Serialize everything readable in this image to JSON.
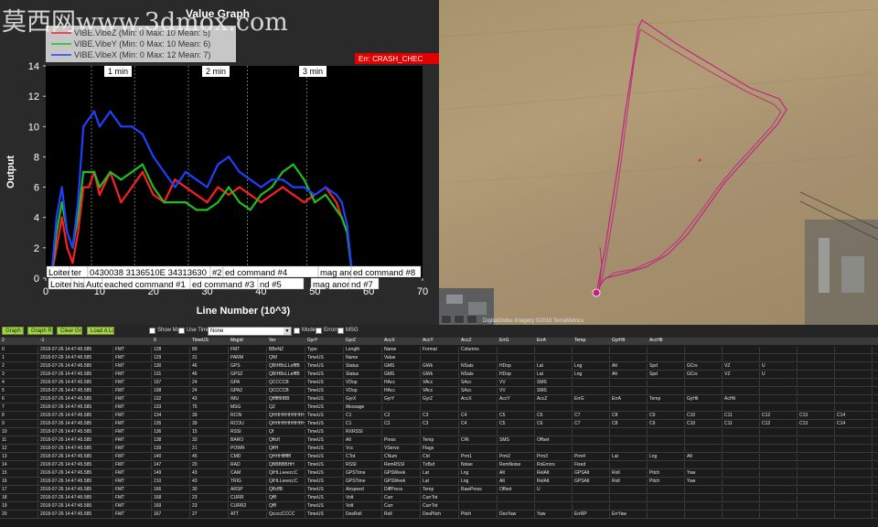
{
  "watermark": "莫西网www.3dmox.com",
  "graph": {
    "title": "Value Graph",
    "legend": [
      {
        "label": "VIBE.VibeZ (Min: 0 Max: 10 Mean: 5)",
        "color": "#ff2020"
      },
      {
        "label": "VIBE.VibeY (Min: 0 Max: 10 Mean: 6)",
        "color": "#1fbf1f"
      },
      {
        "label": "VIBE.VibeX (Min: 0 Max: 12 Mean: 7)",
        "color": "#2040ff"
      }
    ],
    "err_label": "Err: CRASH_CHEC",
    "time_markers": [
      "1 min",
      "2 min",
      "3 min"
    ],
    "mode_labels_row1": [
      "Loiter",
      "ter",
      "0430038 3136510E 34313630",
      "#2",
      "ed command #4",
      "mag anomaly",
      "ed command #8"
    ],
    "mode_labels_row2": [
      "Loiter",
      "his",
      "Auto",
      "eached command #1",
      "ed command #3",
      "nd #5",
      "mag anomaly",
      "nd #7"
    ]
  },
  "chart_data": {
    "type": "line",
    "xlabel": "Line Number (10^3)",
    "ylabel": "Output",
    "xlim": [
      0,
      70
    ],
    "ylim": [
      0,
      14
    ],
    "xticks": [
      0,
      10,
      20,
      30,
      40,
      50,
      60,
      70
    ],
    "yticks": [
      0,
      2,
      4,
      6,
      8,
      10,
      12,
      14
    ],
    "series": [
      {
        "name": "VIBE.VibeZ",
        "color": "#ff2020",
        "x": [
          1,
          2,
          3,
          4,
          5,
          6,
          7,
          8,
          9,
          10,
          12,
          14,
          16,
          18,
          20,
          22,
          24,
          26,
          28,
          30,
          32,
          34,
          36,
          38,
          40,
          42,
          44,
          46,
          48,
          50,
          52,
          54,
          55,
          56,
          57
        ],
        "y": [
          0,
          2,
          4,
          2,
          1,
          3,
          6,
          6,
          7,
          5.5,
          7,
          5,
          6,
          7,
          5.5,
          5,
          6.5,
          6,
          5.5,
          5,
          6,
          5.5,
          6,
          5.5,
          5,
          5.5,
          6,
          5.5,
          5,
          5.5,
          6,
          5,
          4,
          3,
          0
        ]
      },
      {
        "name": "VIBE.VibeY",
        "color": "#1fbf1f",
        "x": [
          1,
          2,
          3,
          4,
          5,
          6,
          7,
          8,
          9,
          10,
          12,
          14,
          16,
          18,
          20,
          22,
          24,
          26,
          28,
          30,
          32,
          34,
          36,
          38,
          40,
          42,
          44,
          46,
          48,
          50,
          52,
          54,
          55,
          56,
          57
        ],
        "y": [
          0,
          3,
          5,
          3,
          2,
          4,
          7,
          7,
          7,
          6,
          7,
          6.5,
          7,
          7.5,
          6,
          5,
          5,
          5,
          4.5,
          4.5,
          5,
          6,
          5,
          4.5,
          5.5,
          6,
          7,
          7.5,
          6.5,
          5,
          5.5,
          4.5,
          4,
          3,
          0
        ]
      },
      {
        "name": "VIBE.VibeX",
        "color": "#2040ff",
        "x": [
          1,
          2,
          3,
          4,
          5,
          6,
          7,
          8,
          9,
          10,
          12,
          14,
          16,
          18,
          20,
          22,
          24,
          26,
          28,
          30,
          32,
          34,
          36,
          38,
          40,
          42,
          44,
          46,
          48,
          50,
          52,
          54,
          55,
          56,
          57
        ],
        "y": [
          0,
          4,
          6,
          3,
          2,
          5,
          10,
          10.5,
          11,
          10,
          11,
          10,
          10,
          9.5,
          8,
          7,
          6,
          7,
          6.5,
          6,
          7.5,
          8,
          7,
          6.5,
          6,
          6.5,
          6.5,
          6,
          6,
          5.5,
          6,
          5.5,
          5,
          3.5,
          0
        ]
      }
    ]
  },
  "map": {
    "attribution": "DigitalGlobe Imagery ©2016 TerraMetrics",
    "track_color": "#c0247f"
  },
  "controls": {
    "buttons": [
      "Graph Left",
      "Graph Right",
      "Clear Graph",
      "Load A Log"
    ],
    "show_map": "Show Map",
    "use_time": "Use Time",
    "dropdown_value": "None",
    "mode": "Mode",
    "errors": "Errors",
    "msg": "MSG"
  },
  "table": {
    "header": [
      "2",
      "-1",
      "",
      "0",
      "TimeUS",
      "MsgId",
      "Ver",
      "GyrY",
      "GyrZ",
      "AccX",
      "AccY",
      "AccZ",
      "ErrG",
      "ErrA",
      "Temp",
      "GyrHlt",
      "AccHlt",
      "",
      "",
      "",
      "",
      "",
      ""
    ],
    "rows": [
      [
        "0",
        "2018-07-26 14:47:45.585",
        "FMT",
        "128",
        "89",
        "FMT",
        "BBnNZ",
        "Type",
        "Length",
        "Name",
        "Format",
        "Columns",
        "",
        "",
        "",
        "",
        "",
        "",
        "",
        "",
        "",
        "",
        ""
      ],
      [
        "1",
        "2018-07-26 14:47:45.585",
        "FMT",
        "129",
        "31",
        "PARM",
        "QNf",
        "TimeUS",
        "Name",
        "Value",
        "",
        "",
        "",
        "",
        "",
        "",
        "",
        "",
        "",
        "",
        "",
        "",
        ""
      ],
      [
        "2",
        "2018-07-26 14:47:45.585",
        "FMT",
        "130",
        "46",
        "GPS",
        "QBIHBcLLefffB",
        "TimeUS",
        "Status",
        "GMS",
        "GWk",
        "NSats",
        "HDop",
        "Lat",
        "Lng",
        "Alt",
        "Spd",
        "GCrs",
        "VZ",
        "U",
        "",
        "",
        ""
      ],
      [
        "3",
        "2018-07-26 14:47:45.585",
        "FMT",
        "131",
        "46",
        "GPS2",
        "QBIHBcLLefffB",
        "TimeUS",
        "Status",
        "GMS",
        "GWk",
        "NSats",
        "HDop",
        "Lat",
        "Lng",
        "Alt",
        "Spd",
        "GCrs",
        "VZ",
        "U",
        "",
        "",
        ""
      ],
      [
        "4",
        "2018-07-26 14:47:45.585",
        "FMT",
        "197",
        "24",
        "GPA",
        "QCCCCB",
        "TimeUS",
        "VDop",
        "HAcc",
        "VAcc",
        "SAcc",
        "VV",
        "SMS",
        "",
        "",
        "",
        "",
        "",
        "",
        "",
        "",
        ""
      ],
      [
        "5",
        "2018-07-26 14:47:45.585",
        "FMT",
        "198",
        "24",
        "GPA2",
        "QCCCCB",
        "TimeUS",
        "VDop",
        "HAcc",
        "VAcc",
        "SAcc",
        "VV",
        "SMS",
        "",
        "",
        "",
        "",
        "",
        "",
        "",
        "",
        ""
      ],
      [
        "6",
        "2018-07-26 14:47:45.585",
        "FMT",
        "132",
        "43",
        "IMU",
        "QffffffIIfBB",
        "TimeUS",
        "GyrX",
        "GyrY",
        "GyrZ",
        "AccX",
        "AccY",
        "AccZ",
        "ErrG",
        "ErrA",
        "Temp",
        "GyHlt",
        "AcHlt",
        "",
        "",
        "",
        ""
      ],
      [
        "7",
        "2018-07-26 14:47:45.585",
        "FMT",
        "133",
        "75",
        "MSG",
        "QZ",
        "TimeUS",
        "Message",
        "",
        "",
        "",
        "",
        "",
        "",
        "",
        "",
        "",
        "",
        "",
        "",
        "",
        ""
      ],
      [
        "8",
        "2018-07-26 14:47:45.585",
        "FMT",
        "134",
        "39",
        "RCIN",
        "QHHHHHHHHHHHHHH",
        "TimeUS",
        "C1",
        "C2",
        "C3",
        "C4",
        "C5",
        "C6",
        "C7",
        "C8",
        "C9",
        "C10",
        "C11",
        "C12",
        "C13",
        "C14"
      ],
      [
        "9",
        "2018-07-26 14:47:45.585",
        "FMT",
        "135",
        "39",
        "RCOU",
        "QHHHHHHHHHHHHHH",
        "TimeUS",
        "C1",
        "C2",
        "C3",
        "C4",
        "C5",
        "C6",
        "C7",
        "C8",
        "C9",
        "C10",
        "C11",
        "C12",
        "C13",
        "C14"
      ],
      [
        "10",
        "2018-07-26 14:47:45.585",
        "FMT",
        "136",
        "15",
        "RSSI",
        "Qf",
        "TimeUS",
        "RXRSSI",
        "",
        "",
        "",
        "",
        "",
        "",
        "",
        "",
        "",
        "",
        "",
        "",
        "",
        ""
      ],
      [
        "11",
        "2018-07-26 14:47:45.585",
        "FMT",
        "138",
        "33",
        "BARO",
        "QffcfI",
        "TimeUS",
        "Alt",
        "Press",
        "Temp",
        "CRt",
        "SMS",
        "Offset",
        "",
        "",
        "",
        "",
        "",
        "",
        "",
        "",
        ""
      ],
      [
        "12",
        "2018-07-26 14:47:45.585",
        "FMT",
        "139",
        "21",
        "POWR",
        "QffH",
        "TimeUS",
        "Vcc",
        "VServo",
        "Flags",
        "",
        "",
        "",
        "",
        "",
        "",
        "",
        "",
        "",
        "",
        "",
        ""
      ],
      [
        "13",
        "2018-07-26 14:47:45.585",
        "FMT",
        "140",
        "45",
        "CMD",
        "QHHHfffffff",
        "TimeUS",
        "CTot",
        "CNum",
        "CId",
        "Prm1",
        "Prm2",
        "Prm3",
        "Prm4",
        "Lat",
        "Lng",
        "Alt",
        "",
        "",
        "",
        ""
      ],
      [
        "14",
        "2018-07-26 14:47:45.585",
        "FMT",
        "147",
        "20",
        "RAD",
        "QBBBBBHH",
        "TimeUS",
        "RSSI",
        "RemRSSI",
        "TxBuf",
        "Noise",
        "RemNoise",
        "RxErrors",
        "Fixed",
        "",
        "",
        "",
        "",
        "",
        "",
        ""
      ],
      [
        "15",
        "2018-07-26 14:47:45.585",
        "FMT",
        "149",
        "43",
        "CAM",
        "QIHLLeeeccC",
        "TimeUS",
        "GPSTime",
        "GPSWeek",
        "Lat",
        "Lng",
        "Alt",
        "RelAlt",
        "GPSAlt",
        "Roll",
        "Pitch",
        "Yaw",
        "",
        "",
        "",
        ""
      ],
      [
        "16",
        "2018-07-26 14:47:45.585",
        "FMT",
        "210",
        "43",
        "TRIG",
        "QIHLLeeeccC",
        "TimeUS",
        "GPSTime",
        "GPSWeek",
        "Lat",
        "Lng",
        "Alt",
        "RelAlt",
        "GPSAlt",
        "Roll",
        "Pitch",
        "Yaw",
        "",
        "",
        "",
        ""
      ],
      [
        "17",
        "2018-07-26 14:47:45.585",
        "FMT",
        "166",
        "30",
        "ARSP",
        "QffcffB",
        "TimeUS",
        "Airspeed",
        "DiffPress",
        "Temp",
        "RawPress",
        "Offset",
        "U",
        "",
        "",
        "",
        "",
        "",
        "",
        "",
        ""
      ],
      [
        "18",
        "2018-07-26 14:47:45.585",
        "FMT",
        "168",
        "23",
        "CURR",
        "Qfff",
        "TimeUS",
        "Volt",
        "Curr",
        "CurrTot",
        "",
        "",
        "",
        "",
        "",
        "",
        "",
        "",
        "",
        "",
        ""
      ],
      [
        "19",
        "2018-07-26 14:47:45.585",
        "FMT",
        "169",
        "23",
        "CURR2",
        "Qfff",
        "TimeUS",
        "Volt",
        "Curr",
        "CurrTot",
        "",
        "",
        "",
        "",
        "",
        "",
        "",
        "",
        "",
        "",
        ""
      ],
      [
        "20",
        "2018-07-26 14:47:45.585",
        "FMT",
        "167",
        "27",
        "ATT",
        "QccccCCCC",
        "TimeUS",
        "DesRoll",
        "Roll",
        "DesPitch",
        "Pitch",
        "DesYaw",
        "Yaw",
        "ErrRP",
        "ErrYaw",
        "",
        "",
        "",
        "",
        ""
      ]
    ]
  }
}
